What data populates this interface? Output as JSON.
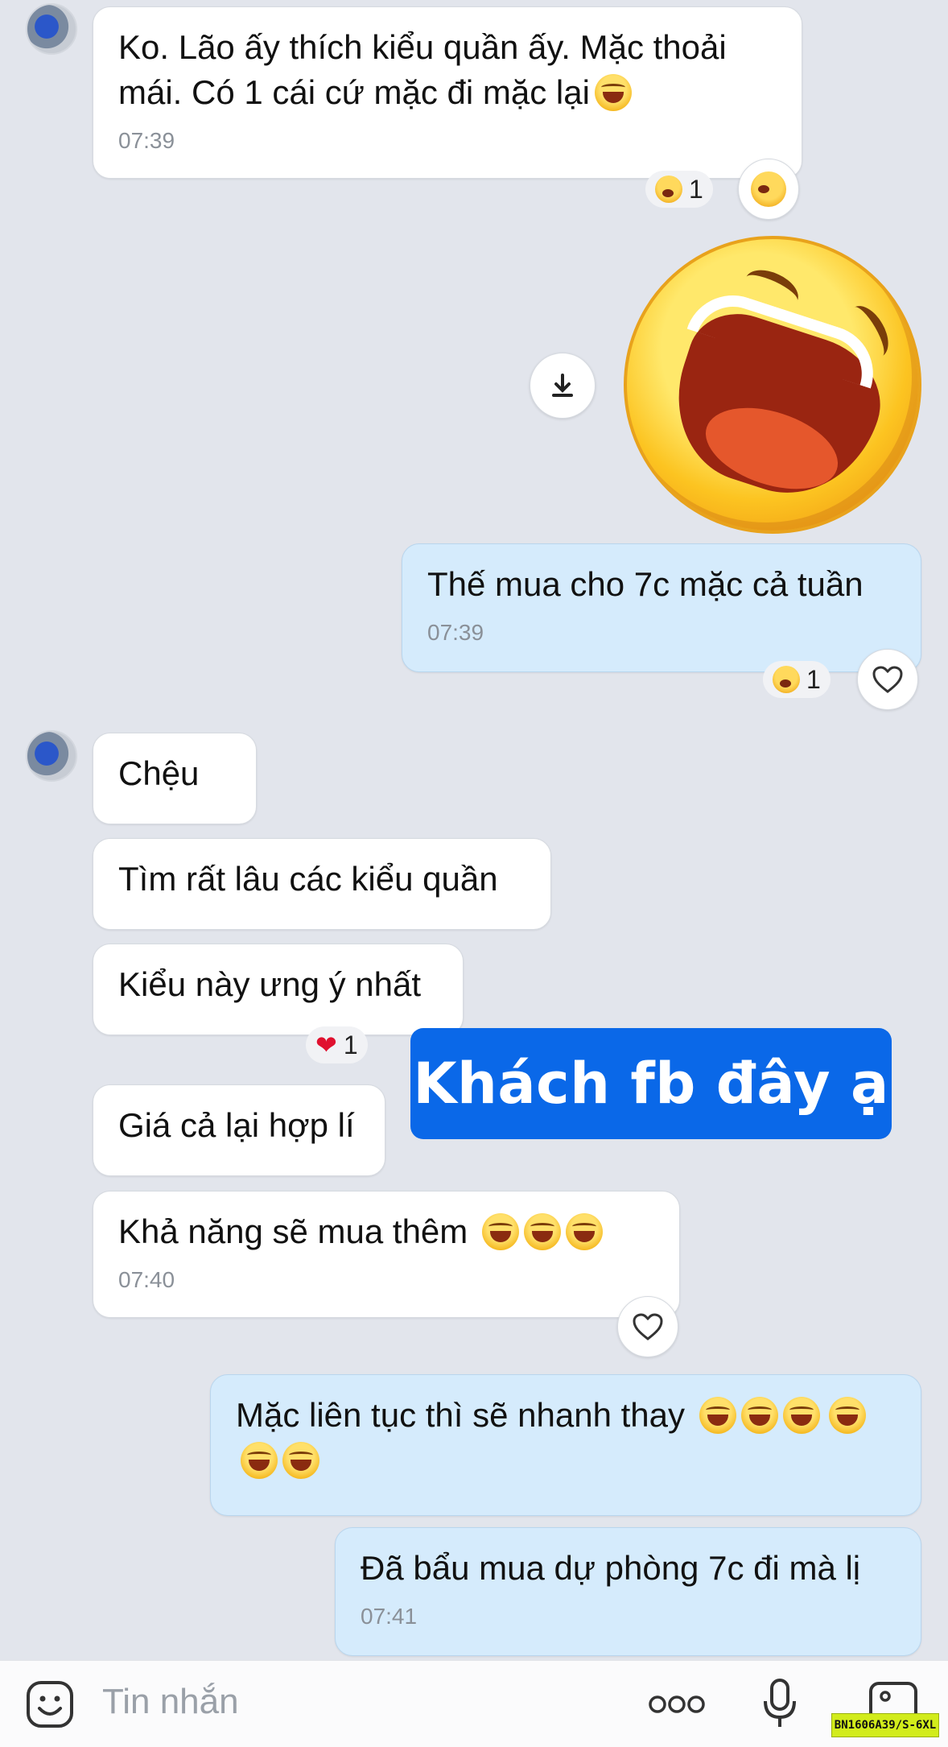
{
  "messages": {
    "m1": {
      "text": "Ko. Lão ấy thích kiểu quần ấy. Mặc thoải mái. Có 1 cái cứ mặc đi mặc lại",
      "time": "07:39",
      "reaction_count": "1"
    },
    "m2": {
      "text": "Thế mua cho 7c mặc cả tuần",
      "time": "07:39",
      "reaction_count": "1"
    },
    "m3": {
      "text": "Chệu"
    },
    "m4": {
      "text": "Tìm rất lâu các kiểu quần"
    },
    "m5": {
      "text": "Kiểu này ưng ý nhất",
      "reaction_count": "1"
    },
    "m6": {
      "text": "Giá cả lại hợp lí"
    },
    "m7": {
      "text": "Khả năng sẽ mua thêm",
      "time": "07:40"
    },
    "m8": {
      "text": "Mặc liên tục thì sẽ nhanh thay"
    },
    "m9": {
      "text": "Đã bẩu mua dự phòng 7c đi mà lị",
      "time": "07:41"
    }
  },
  "overlay": {
    "banner": "Khách fb đây ạ",
    "tag": "BN1606A39/S-6XL"
  },
  "input": {
    "placeholder": "Tin nhắn"
  },
  "icons": {
    "emoji": "laughing-face",
    "sticker": "laughing-face-sticker",
    "download": "download-icon",
    "heart": "heart-icon",
    "more": "more-dots-icon",
    "mic": "microphone-icon",
    "image": "image-icon"
  },
  "colors": {
    "background": "#e2e5ec",
    "outgoing": "#d5ebfc",
    "incoming": "#ffffff",
    "banner": "#0a68e8",
    "tag": "#d2ec1b"
  }
}
